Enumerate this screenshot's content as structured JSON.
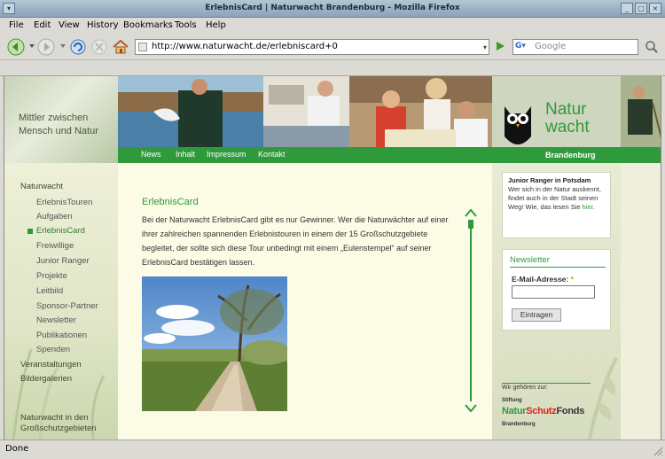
{
  "window": {
    "title": "ErlebnisCard | Naturwacht Brandenburg - Mozilla Firefox"
  },
  "menu": {
    "file": "File",
    "edit": "Edit",
    "view": "View",
    "history": "History",
    "bookmarks": "Bookmarks",
    "tools": "Tools",
    "help": "Help"
  },
  "toolbar": {
    "url": "http://www.naturwacht.de/erlebniscard+0",
    "search_placeholder": "Google"
  },
  "header": {
    "tagline_line1": "Mittler zwischen",
    "tagline_line2": "Mensch und Natur",
    "nav": [
      "News",
      "Inhalt",
      "Impressum",
      "Kontakt"
    ],
    "logo_line1": "Natur",
    "logo_line2": "wacht",
    "logo_brand": "Brandenburg"
  },
  "sidebar": {
    "title": "Naturwacht",
    "items": [
      "ErlebnisTouren",
      "Aufgaben",
      "ErlebnisCard",
      "Freiwillige",
      "Junior Ranger",
      "Projekte",
      "Leitbild",
      "Sponsor-Partner",
      "Newsletter",
      "Publikationen",
      "Spenden"
    ],
    "veranstaltungen": "Veranstaltungen",
    "bildergalerien": "Bildergalerien",
    "bottom_line1": "Naturwacht in den",
    "bottom_line2": "Großschutzgebieten"
  },
  "content": {
    "heading": "ErlebnisCard",
    "text": "Bei der Naturwacht ErlebnisCard gibt es nur Gewinner. Wer die Naturwächter auf einer ihrer zahlreichen spannenden Erlebnistouren in einem der 15 Großschutzgebiete begleitet, der sollte sich diese Tour unbedingt mit einem „Eulenstempel“ auf seiner ErlebnisCard bestätigen lassen."
  },
  "right": {
    "junior_title": "Junior Ranger in Potsdam",
    "junior_text": "Wer sich in der Natur auskennt, findet auch in der Stadt seinen Weg! Wie, das lesen Sie",
    "junior_link": "hier",
    "junior_end": ".",
    "newsletter_title": "Newsletter",
    "email_label": "E-Mail-Adresse:",
    "required_mark": "*",
    "submit": "Eintragen",
    "belong": "Wir gehören zur:",
    "stiftung": "Stiftung",
    "nsf_natur": "Natur",
    "nsf_schutz": "Schutz",
    "nsf_fonds": "Fonds",
    "nsf_brand": "Brandenburg"
  },
  "status": {
    "text": "Done"
  }
}
